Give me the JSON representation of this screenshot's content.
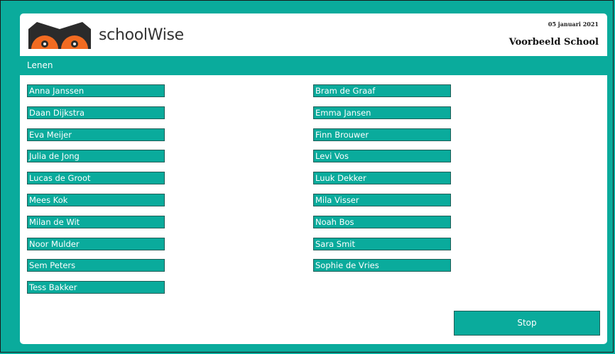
{
  "header": {
    "brand": "schoolWise",
    "date": "05 januari 2021",
    "school": "Voorbeeld School"
  },
  "titlebar": {
    "label": "Lenen"
  },
  "students": {
    "left": [
      "Anna Janssen",
      "Daan Dijkstra",
      "Eva Meijer",
      "Julia de Jong",
      "Lucas de Groot",
      "Mees Kok",
      "Milan de Wit",
      "Noor Mulder",
      "Sem Peters",
      "Tess Bakker"
    ],
    "right": [
      "Bram de Graaf",
      "Emma Jansen",
      "Finn Brouwer",
      "Levi Vos",
      "Luuk Dekker",
      "Mila Visser",
      "Noah Bos",
      "Sara Smit",
      "Sophie de Vries"
    ]
  },
  "actions": {
    "stop": "Stop"
  },
  "colors": {
    "accent": "#0aab9c",
    "logo_orange": "#f26b21",
    "logo_dark": "#2b2b2b"
  },
  "icons": {
    "logo": "owl-eyes-logo"
  }
}
